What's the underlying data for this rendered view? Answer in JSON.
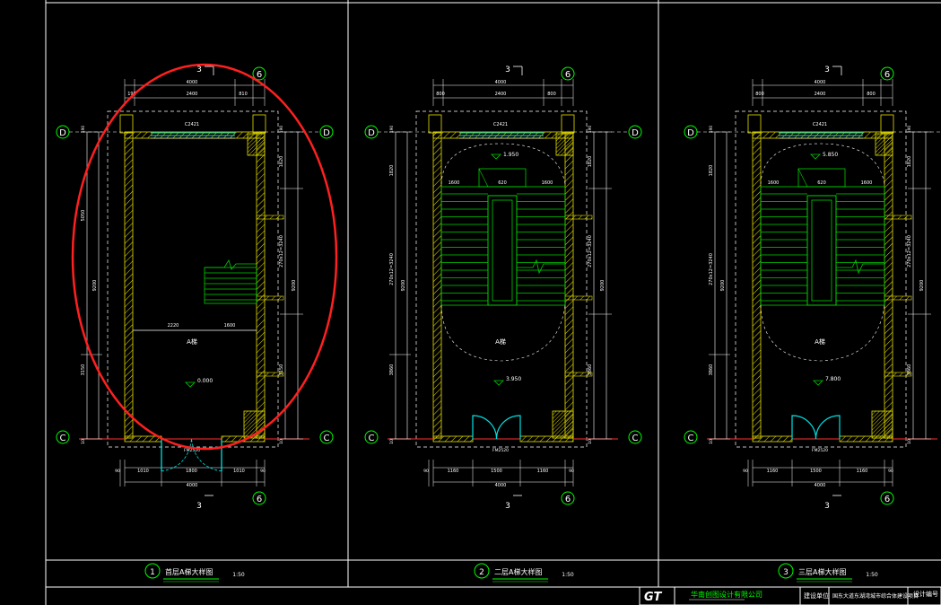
{
  "colors": {
    "background": "#000000",
    "frame": "#ffffff",
    "wall": "#e8e000",
    "stair": "#00d000",
    "door": "#00e0e0",
    "dim": "#ffffff",
    "grid_bubble": "#00ff00",
    "axis_line": "#ff3030",
    "highlight": "#ff2020",
    "title_green": "#00ff00"
  },
  "grid_labels": {
    "top": "D",
    "bottom": "C",
    "right": "6",
    "section": "3"
  },
  "plans": [
    {
      "name": "plan-1",
      "top_dims": {
        "overall": "4000",
        "left": "190",
        "middle": "2400",
        "right": "810"
      },
      "bottom_dims": {
        "overall": "4000",
        "left": "1010",
        "middle": "1800",
        "right": "1010",
        "edge_left": "90",
        "edge_right": "90"
      },
      "left_dims": {
        "upper": "5050",
        "overall": "9200",
        "lower": "3150",
        "top_edge": "190",
        "bottom_edge": "10"
      },
      "right_dims": {
        "upper": "1620",
        "middle": "270x12=3240",
        "overall": "9200",
        "lower": "3150",
        "top_edge": "190",
        "bottom_edge": "10"
      },
      "window_tag": "C2421",
      "door_tag": "FM2520",
      "room_label": "A梯",
      "level": "0.000",
      "landing_dims": {
        "left": "2220",
        "right": "1600"
      },
      "flight_dims": null,
      "title_num": "1",
      "title": "首层A梯大样图",
      "scale": "1:50"
    },
    {
      "name": "plan-2",
      "top_dims": {
        "overall": "4000",
        "left": "800",
        "middle": "2400",
        "right": "800"
      },
      "bottom_dims": {
        "overall": "4000",
        "left": "1160",
        "middle": "1500",
        "right": "1160",
        "edge_left": "90",
        "edge_right": "90"
      },
      "left_dims": {
        "upper": "1820",
        "middle": "270x12=3240",
        "overall": "9200",
        "lower": "3860",
        "top_edge": "190",
        "bottom_edge": "10"
      },
      "right_dims": {
        "upper": "1820",
        "middle": "270x12=3240",
        "overall": "9200",
        "lower": "3860",
        "top_edge": "190",
        "bottom_edge": "10"
      },
      "window_tag": "C2421",
      "door_tag": "FM2520",
      "room_label": "A梯",
      "level": "3.950",
      "upper_level": "1.950",
      "landing_dims": null,
      "flight_dims": {
        "left": "1600",
        "middle": "620",
        "right": "1600"
      },
      "title_num": "2",
      "title": "二层A梯大样图",
      "scale": "1:50"
    },
    {
      "name": "plan-3",
      "top_dims": {
        "overall": "4000",
        "left": "800",
        "middle": "2400",
        "right": "800"
      },
      "bottom_dims": {
        "overall": "4000",
        "left": "1160",
        "middle": "1500",
        "right": "1160",
        "edge_left": "90",
        "edge_right": "90"
      },
      "left_dims": {
        "upper": "1820",
        "middle": "270x12=3240",
        "overall": "9200",
        "lower": "3860",
        "top_edge": "190",
        "bottom_edge": "10"
      },
      "right_dims": {
        "upper": "1820",
        "middle": "270x12=3240",
        "overall": "9200",
        "lower": "3860",
        "top_edge": "190",
        "bottom_edge": "10"
      },
      "window_tag": "C2421",
      "door_tag": "FM2520",
      "room_label": "A梯",
      "level": "7.800",
      "upper_level": "5.850",
      "landing_dims": null,
      "flight_dims": {
        "left": "1600",
        "middle": "620",
        "right": "1600"
      },
      "title_num": "3",
      "title": "三层A梯大样图",
      "scale": "1:50"
    }
  ],
  "title_block": {
    "logo": "GT",
    "company": "华南创图设计有限公司",
    "project_label": "建设单位",
    "project": "国东大道东湖湾城市综合体建设项目",
    "design_no_label": "设计编号"
  }
}
